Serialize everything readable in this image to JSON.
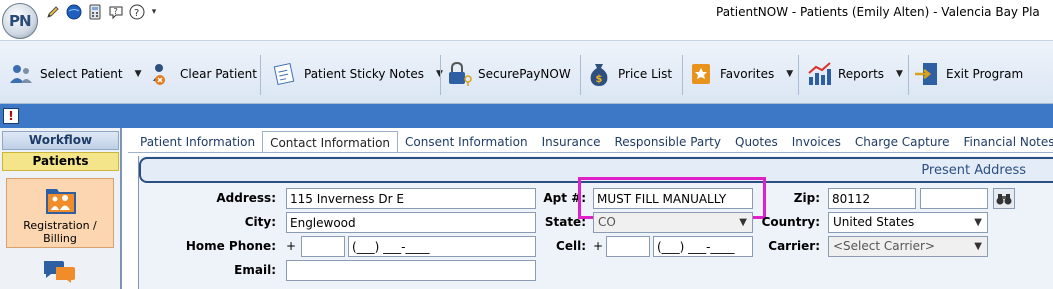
{
  "window": {
    "title": "PatientNOW - Patients (Emily Alten) - Valencia Bay Pla",
    "logo_text": "PN"
  },
  "quick_access": {
    "icons": [
      "pencil-icon",
      "globe-icon",
      "calculator-icon",
      "help-icon",
      "help-question-icon"
    ],
    "dropdown": "▾"
  },
  "ribbon": {
    "select_patient": "Select Patient",
    "clear_patient": "Clear Patient",
    "sticky_notes": "Patient Sticky Notes",
    "secure_pay": "SecurePayNOW",
    "price_list": "Price List",
    "favorites": "Favorites",
    "reports": "Reports",
    "exit": "Exit Program"
  },
  "alert_button": "!",
  "workflow": {
    "header": "Workflow",
    "patients": "Patients",
    "registration": "Registration / Billing"
  },
  "tabs": [
    {
      "label": "Patient Information",
      "active": false
    },
    {
      "label": "Contact Information",
      "active": true
    },
    {
      "label": "Consent Information",
      "active": false
    },
    {
      "label": "Insurance",
      "active": false
    },
    {
      "label": "Responsible Party",
      "active": false
    },
    {
      "label": "Quotes",
      "active": false
    },
    {
      "label": "Invoices",
      "active": false
    },
    {
      "label": "Charge Capture",
      "active": false
    },
    {
      "label": "Financial Notes",
      "active": false
    }
  ],
  "section": {
    "title": "Present Address"
  },
  "form": {
    "address_label": "Address:",
    "address_value": "115 Inverness Dr E",
    "apt_label": "Apt #:",
    "apt_value": "MUST FILL MANUALLY",
    "zip_label": "Zip:",
    "zip_value": "80112",
    "zip_ext_value": "",
    "city_label": "City:",
    "city_value": "Englewood",
    "state_label": "State:",
    "state_value": "CO",
    "country_label": "Country:",
    "country_value": "United States",
    "home_phone_label": "Home Phone:",
    "home_phone_plus": "+",
    "home_phone_code": "",
    "home_phone_value": "(___) ___-____",
    "cell_label": "Cell:",
    "cell_plus": "+",
    "cell_code": "",
    "cell_value": "(___) ___-____",
    "carrier_label": "Carrier:",
    "carrier_value": "<Select Carrier>",
    "email_label": "Email:",
    "email_value": ""
  },
  "colors": {
    "highlight": "#e020c8",
    "alert_bar": "#3d78c7",
    "section_border": "#2b4f82"
  }
}
